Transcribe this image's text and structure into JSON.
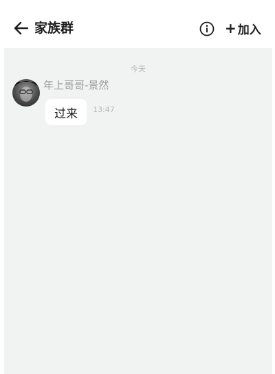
{
  "header": {
    "title": "家族群",
    "join_label": "加入",
    "join_plus": "+",
    "back_icon": "back-arrow-icon",
    "info_icon": "info-icon"
  },
  "chat": {
    "date_separator": "今天",
    "messages": [
      {
        "sender": "年上哥哥-景然",
        "text": "过来",
        "time": "13:47",
        "avatar": "user-avatar"
      }
    ]
  },
  "colors": {
    "chat_background": "#f1f3f2",
    "bubble": "#ffffff",
    "meta_text": "#9a9a9a"
  }
}
